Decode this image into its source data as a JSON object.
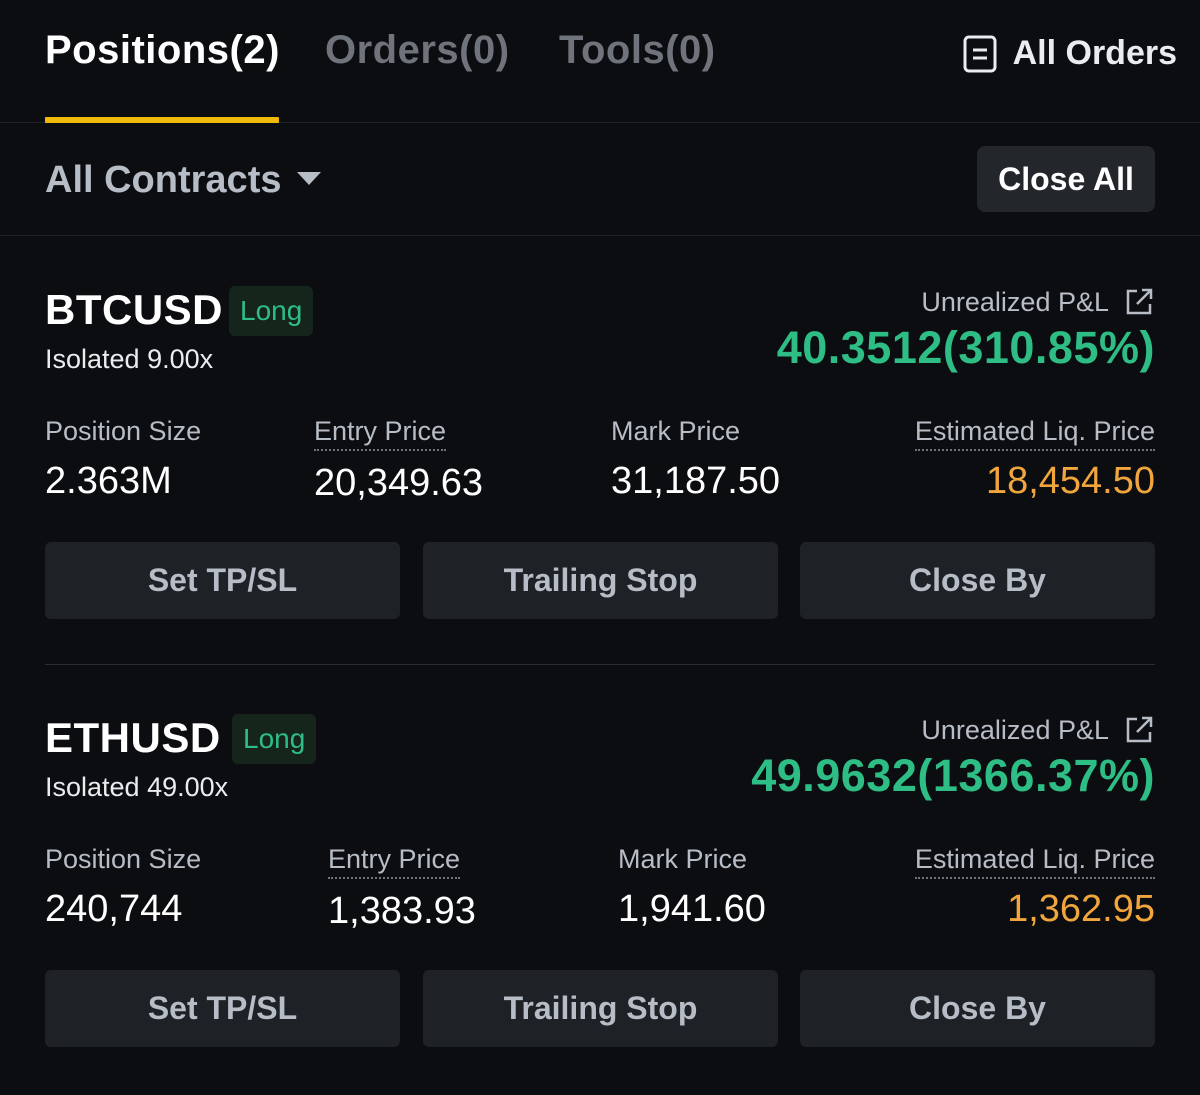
{
  "tabs": {
    "positions": "Positions(2)",
    "orders": "Orders(0)",
    "tools": "Tools(0)"
  },
  "all_orders": {
    "label": "All Orders",
    "icon": "document-list-icon"
  },
  "filter": {
    "contracts_label": "All Contracts",
    "close_all_label": "Close All"
  },
  "labels": {
    "unrealized_pnl": "Unrealized P&L",
    "position_size": "Position Size",
    "entry_price": "Entry Price",
    "mark_price": "Mark Price",
    "est_liq_price": "Estimated Liq. Price"
  },
  "buttons": {
    "set_tpsl": "Set TP/SL",
    "trailing_stop": "Trailing Stop",
    "close_by": "Close By"
  },
  "positions": [
    {
      "symbol": "BTCUSD",
      "side": "Long",
      "leverage": "Isolated 9.00x",
      "pnl": "40.3512(310.85%)",
      "position_size": "2.363M",
      "entry_price": "20,349.63",
      "mark_price": "31,187.50",
      "liq_price": "18,454.50"
    },
    {
      "symbol": "ETHUSD",
      "side": "Long",
      "leverage": "Isolated 49.00x",
      "pnl": "49.9632(1366.37%)",
      "position_size": "240,744",
      "entry_price": "1,383.93",
      "mark_price": "1,941.60",
      "liq_price": "1,362.95"
    }
  ],
  "colors": {
    "background": "#0c0d10",
    "accent": "#f0b90b",
    "profit": "#2ebd85",
    "liquidation": "#f0a53d",
    "button": "#1e2126"
  }
}
